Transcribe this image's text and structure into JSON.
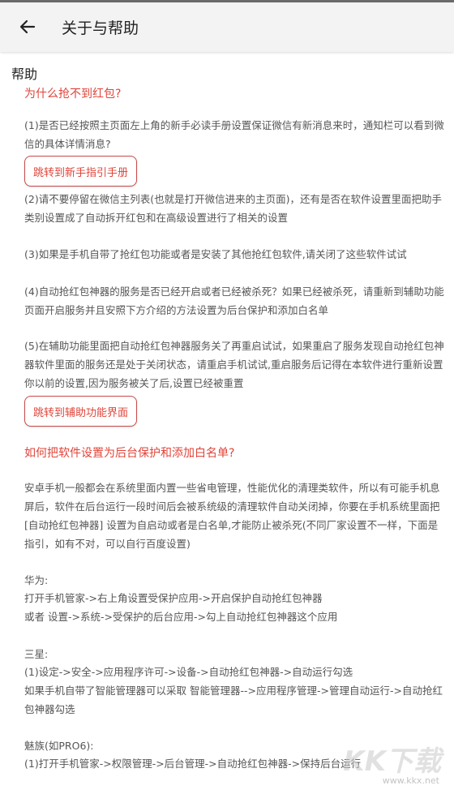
{
  "appbar": {
    "title": "关于与帮助",
    "back_icon": "arrow-left-icon"
  },
  "help": {
    "heading": "帮助",
    "q1": "为什么抢不到红包?",
    "p1": "(1)是否已经按照主页面左上角的新手必读手册设置保证微信有新消息来时，通知栏可以看到微信的具体详情消息?",
    "btn1": "跳转到新手指引手册",
    "p2": "(2)请不要停留在微信主列表(也就是打开微信进来的主页面)，还有是否在软件设置里面把助手类别设置成了自动拆开红包和在高级设置进行了相关的设置",
    "p3": "(3)如果是手机自带了抢红包功能或者是安装了其他抢红包软件,请关闭了这些软件试试",
    "p4": "(4)自动抢红包神器的服务是否已经开启或者已经被杀死？如果已经被杀死，请重新到辅助功能页面开启服务并且安照下方介绍的方法设置为后台保护和添加白名单",
    "p5": "(5)在辅助功能里面把自动抢红包神器服务关了再重启试试，如果重启了服务发现自动抢红包神器软件里面的服务还是处于关闭状态，请重启手机试试,重启服务后记得在本软件进行重新设置你以前的设置,因为服务被关了后,设置已经被重置",
    "btn2": "跳转到辅助功能界面",
    "q2": "如何把软件设置为后台保护和添加白名单?",
    "p6": "安卓手机一般都会在系统里面内置一些省电管理，性能优化的清理类软件，所以有可能手机息屏后，软件在后台运行一段时间后会被系统级的清理软件自动关闭掉，你要在手机系统里面把[自动抢红包神器] 设置为自启动或者是白名单,才能防止被杀死(不同厂家设置不一样，下面是指引，如有不对，可以自行百度设置)",
    "huawei_title": "华为:",
    "huawei_1": "打开手机管家->右上角设置受保护应用->开启保护自动抢红包神器",
    "huawei_2": "或者 设置->系统->受保护的后台应用->勾上自动抢红包神器这个应用",
    "samsung_title": " 三星:",
    "samsung_1": "(1)设定->安全->应用程序许可->设备->自动抢红包神器->自动运行勾选",
    "samsung_2": "如果手机自带了智能管理器可以采取 智能管理器-->应用程序管理->管理自动运行->自动抢红包神器勾选",
    "meizu_title": " 魅族(如PRO6):",
    "meizu_1": "(1)打开手机管家->权限管理->后台管理->自动抢红包神器->保持后台运行"
  },
  "watermark": {
    "logo_text": "KK下载",
    "url": "www.kkx.net"
  },
  "colors": {
    "accent": "#e0443a",
    "appbar_bg": "#f3f3f3",
    "button_border": "#c94a4a"
  }
}
